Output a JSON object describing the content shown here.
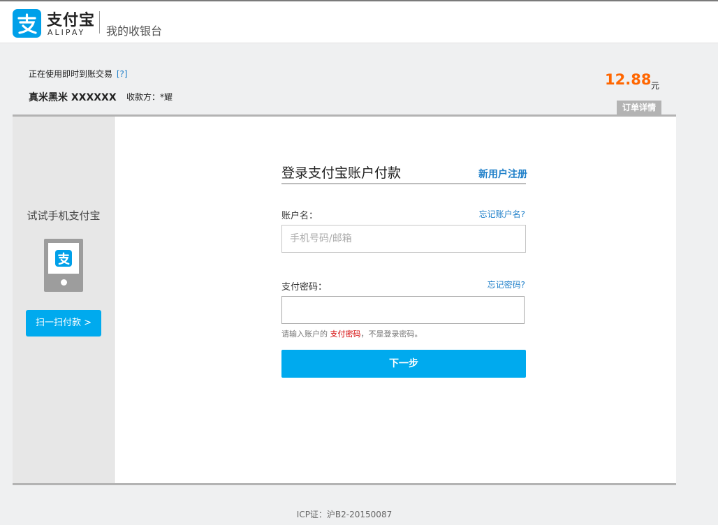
{
  "header": {
    "logo_name": "支付宝",
    "logo_sub": "ALIPAY",
    "cashier_title": "我的收银台"
  },
  "order": {
    "status_text": "正在使用即时到账交易",
    "help_link": "[?]",
    "name": "真米黑米 XXXXXX",
    "payee": "收款方：*耀",
    "amount": "12.88",
    "amount_unit": "元",
    "detail_button": "订单详情"
  },
  "sidebar": {
    "title": "试试手机支付宝",
    "scan_button": "扫一扫付款 >"
  },
  "login": {
    "title": "登录支付宝账户付款",
    "register_link": "新用户注册",
    "account_label": "账户名：",
    "forgot_account": "忘记账户名?",
    "account_placeholder": "手机号码/邮箱",
    "password_label": "支付密码：",
    "forgot_password": "忘记密码?",
    "hint_prefix": "请输入账户的",
    "hint_highlight": "支付密码",
    "hint_suffix": "，不是登录密码。",
    "next_button": "下一步"
  },
  "footer": {
    "icp": "ICP证：沪B2-20150087"
  },
  "colors": {
    "accent": "#00aaee",
    "amount": "#ff6600",
    "link": "#1e7fc9",
    "warning": "#d30000"
  }
}
